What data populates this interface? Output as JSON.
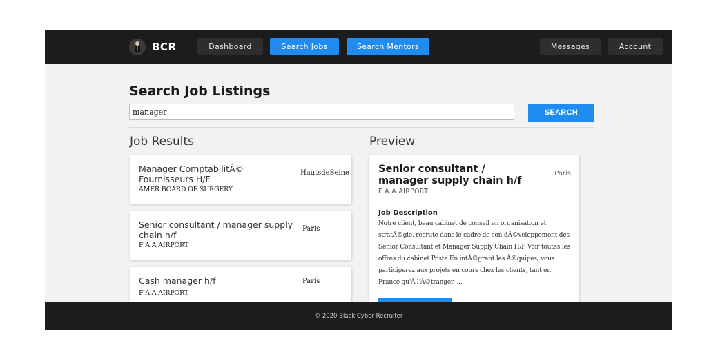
{
  "navbar": {
    "brand": "BCR",
    "items": [
      {
        "label": "Dashboard",
        "active": false
      },
      {
        "label": "Search Jobs",
        "active": true
      },
      {
        "label": "Search Mentors",
        "active": true
      },
      {
        "label": "Messages",
        "active": false
      },
      {
        "label": "Account",
        "active": false
      }
    ]
  },
  "search": {
    "title": "Search Job Listings",
    "query": "manager",
    "button_label": "SEARCH"
  },
  "results": {
    "heading": "Job Results",
    "jobs": [
      {
        "title": "Manager ComptabilitÃ© Fournisseurs H/F",
        "company": "AMER BOARD OF SURGERY",
        "location": "HautsdeSeine"
      },
      {
        "title": "Senior consultant / manager supply chain h/f",
        "company": "F A A AIRPORT",
        "location": "Paris"
      },
      {
        "title": "Cash manager h/f",
        "company": "F A A AIRPORT",
        "location": "Paris"
      }
    ]
  },
  "preview": {
    "heading": "Preview",
    "title": "Senior consultant / manager supply chain h/f",
    "location": "Paris",
    "company": "F A A AIRPORT",
    "description_heading": "Job Description",
    "description": "Notre client, beau cabinet de conseil en organisation et stratÃ©gie, recrute dans le cadre de son dÃ©veloppement des Senior Consultant et Manager Supply Chain H/F Voir toutes les offres du cabinet Poste En intÃ©grant les Ã©quipes, vous participerez aux projets en cours chez les clients, tant en France qu'Ã l'Ã©tranger. ..."
  },
  "footer": {
    "text": "© 2020 Black Cyber Recruiter"
  },
  "colors": {
    "accent": "#1e8cf0",
    "nav_background": "#1c1c1c",
    "page_background": "#f2f2f2"
  }
}
